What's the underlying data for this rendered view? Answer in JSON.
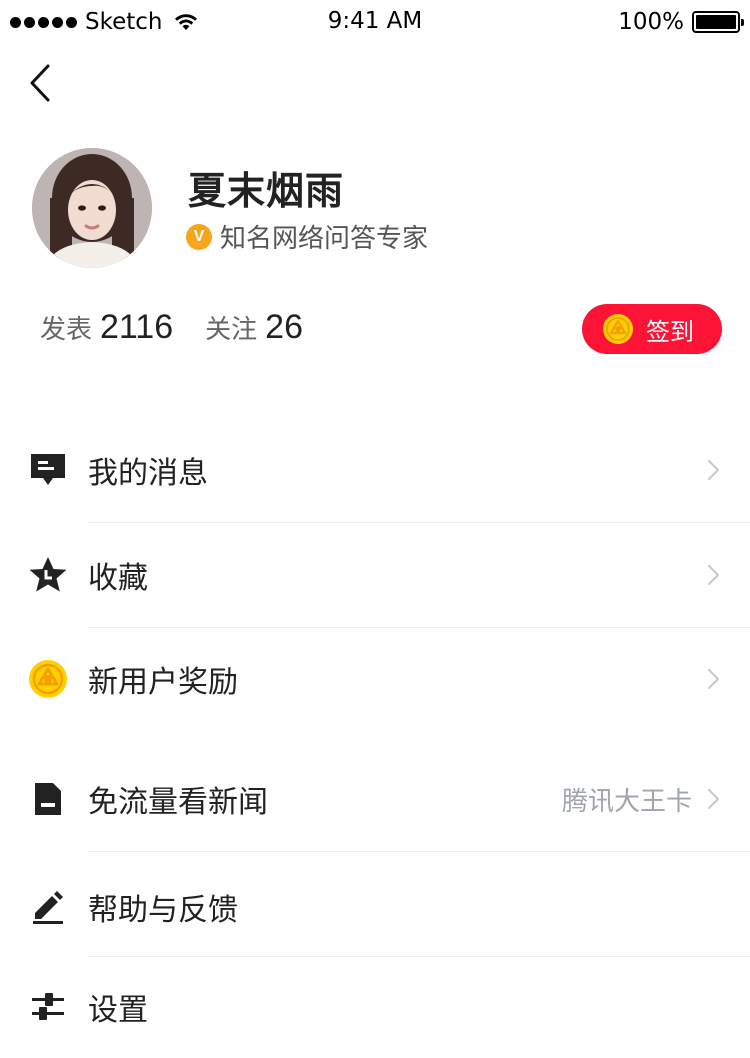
{
  "status_bar": {
    "carrier": "Sketch",
    "time": "9:41 AM",
    "battery": "100%"
  },
  "profile": {
    "name": "夏末烟雨",
    "badge_letter": "V",
    "title": "知名网络问答专家",
    "stats": [
      {
        "label": "发表",
        "value": "2116"
      },
      {
        "label": "关注",
        "value": "26"
      }
    ],
    "checkin_label": "签到"
  },
  "menu": [
    {
      "label": "我的消息",
      "icon": "message-icon",
      "value": ""
    },
    {
      "label": "收藏",
      "icon": "star-icon",
      "value": ""
    },
    {
      "label": "新用户奖励",
      "icon": "coin-icon",
      "value": ""
    },
    {
      "label": "免流量看新闻",
      "icon": "sim-card-icon",
      "value": "腾讯大王卡"
    },
    {
      "label": "帮助与反馈",
      "icon": "edit-icon",
      "value": ""
    },
    {
      "label": "设置",
      "icon": "settings-sliders-icon",
      "value": ""
    }
  ],
  "colors": {
    "accent_red": "#fc1335",
    "badge_orange": "#f7a51d",
    "coin_yellow": "#ffd000"
  }
}
